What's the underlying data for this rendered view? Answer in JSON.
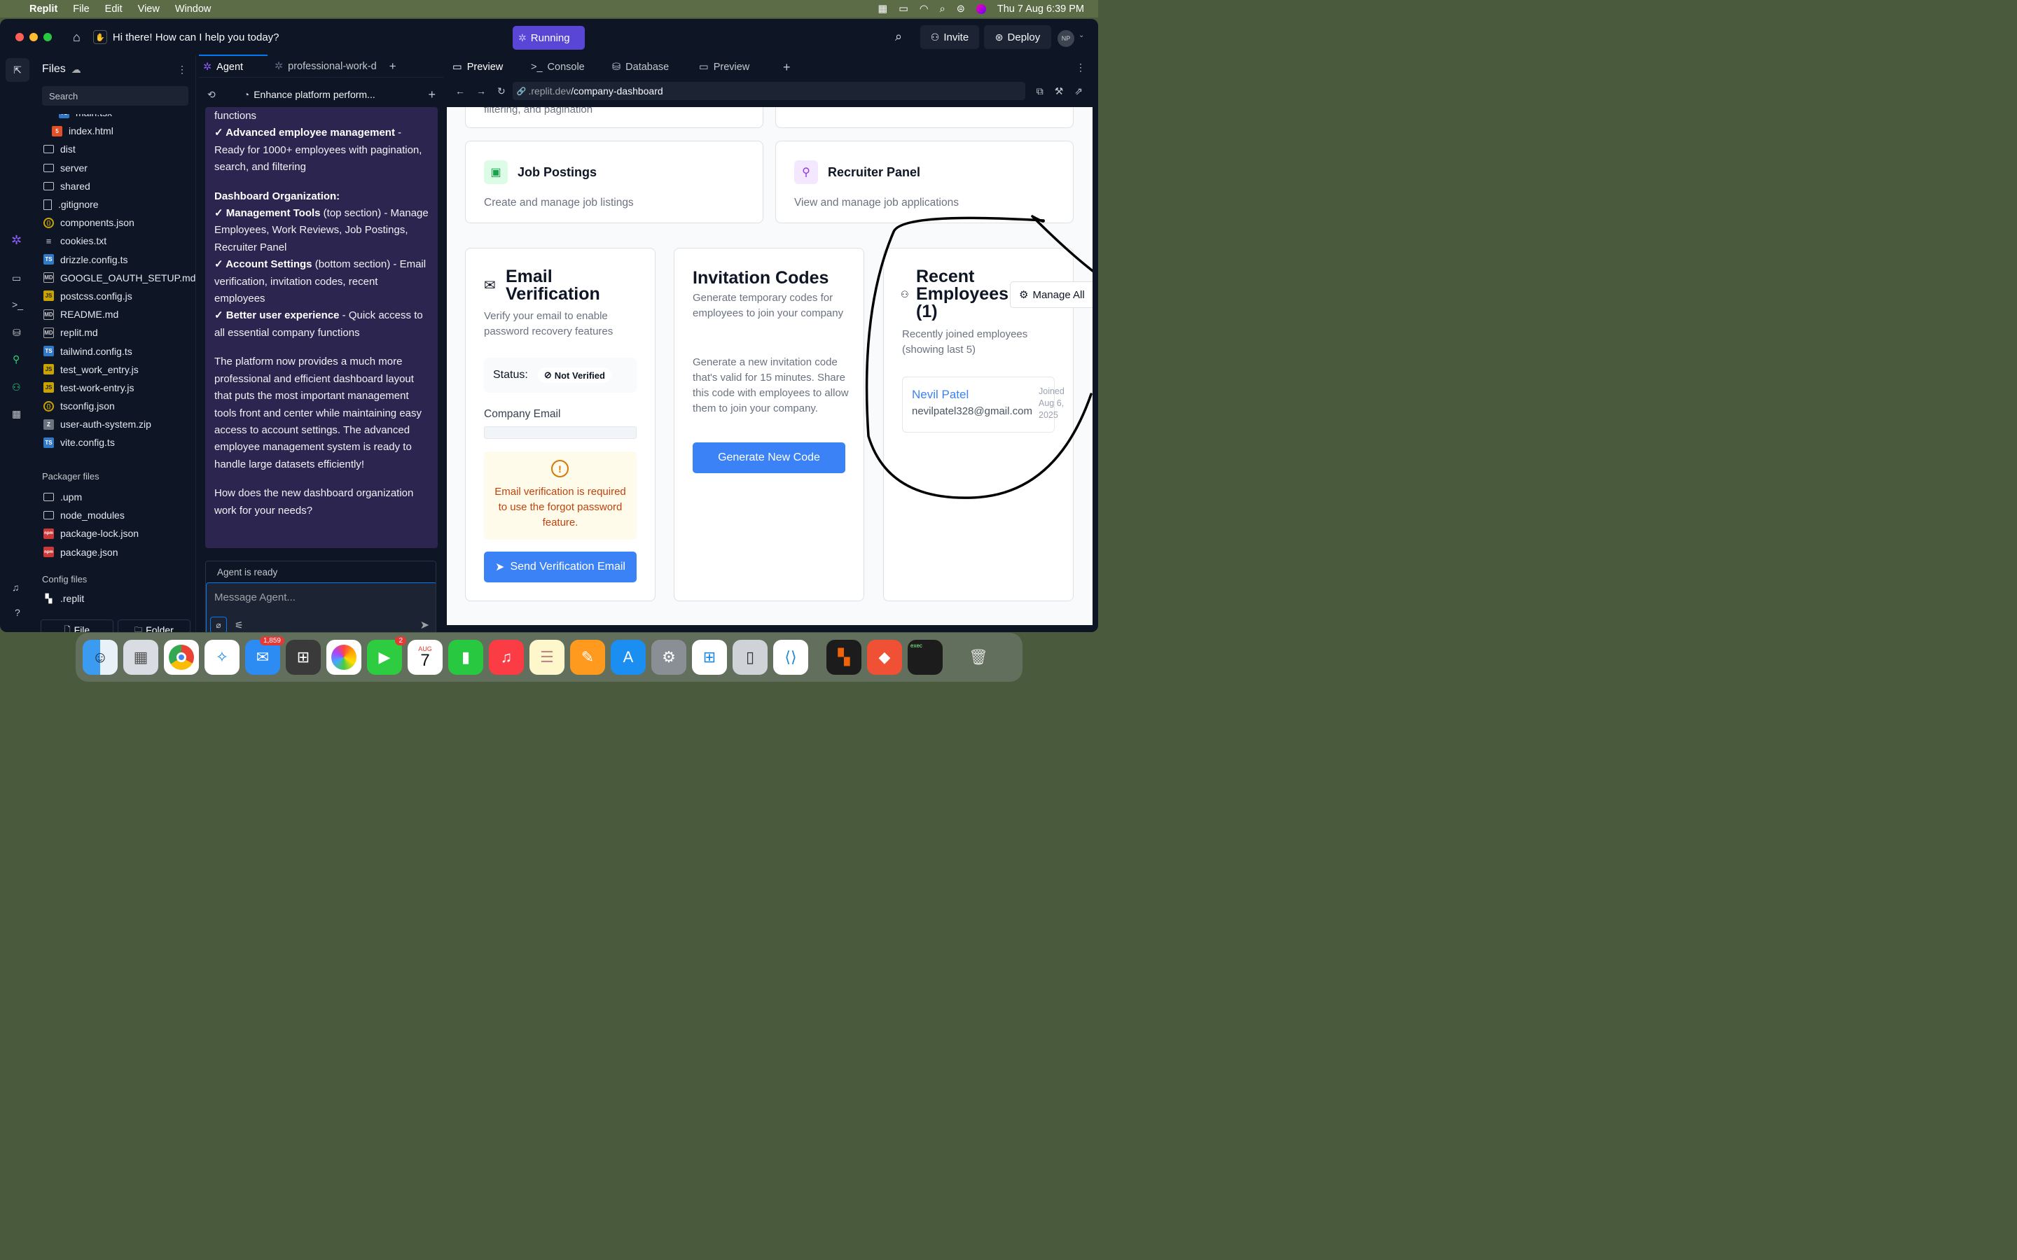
{
  "menubar": {
    "app_name": "Replit",
    "items": [
      "File",
      "Edit",
      "View",
      "Window"
    ],
    "clock": "Thu 7 Aug  6:39 PM"
  },
  "titlebar": {
    "prompt": "Hi there! How can I help you today?",
    "running_label": "Running",
    "invite_label": "Invite",
    "deploy_label": "Deploy",
    "avatar_initials": "NP"
  },
  "files": {
    "header": "Files",
    "search_placeholder": "Search",
    "items": [
      {
        "name": "main.tsx",
        "icon": "ts"
      },
      {
        "name": "index.html",
        "icon": "html"
      },
      {
        "name": "dist",
        "icon": "folder"
      },
      {
        "name": "server",
        "icon": "folder"
      },
      {
        "name": "shared",
        "icon": "folder"
      },
      {
        "name": ".gitignore",
        "icon": "file"
      },
      {
        "name": "components.json",
        "icon": "json"
      },
      {
        "name": "cookies.txt",
        "icon": "txt"
      },
      {
        "name": "drizzle.config.ts",
        "icon": "ts"
      },
      {
        "name": "GOOGLE_OAUTH_SETUP.md",
        "icon": "md"
      },
      {
        "name": "postcss.config.js",
        "icon": "js"
      },
      {
        "name": "README.md",
        "icon": "md"
      },
      {
        "name": "replit.md",
        "icon": "md"
      },
      {
        "name": "tailwind.config.ts",
        "icon": "ts"
      },
      {
        "name": "test_work_entry.js",
        "icon": "js"
      },
      {
        "name": "test-work-entry.js",
        "icon": "js"
      },
      {
        "name": "tsconfig.json",
        "icon": "json"
      },
      {
        "name": "user-auth-system.zip",
        "icon": "zip"
      },
      {
        "name": "vite.config.ts",
        "icon": "ts"
      }
    ],
    "packager_title": "Packager files",
    "packager_items": [
      {
        "name": ".upm",
        "icon": "folder"
      },
      {
        "name": "node_modules",
        "icon": "folder"
      },
      {
        "name": "package-lock.json",
        "icon": "npm"
      },
      {
        "name": "package.json",
        "icon": "npm"
      }
    ],
    "config_title": "Config files",
    "config_items": [
      {
        "name": ".replit",
        "icon": "replit"
      }
    ],
    "new_file_label": "File",
    "new_folder_label": "Folder"
  },
  "chat": {
    "tab_agent": "Agent",
    "tab_other": "professional-work-d",
    "thread_title": "Enhance platform perform...",
    "msg": {
      "p0": "functions",
      "p1_check": "✓ ",
      "p1_bold": "Advanced employee management",
      "p1_rest": " - Ready for 1000+ employees with pagination, search, and filtering",
      "p2_title": "Dashboard Organization:",
      "p3_bold": "Management Tools",
      "p3_rest": " (top section) - Manage Employees, Work Reviews, Job Postings, Recruiter Panel",
      "p4_bold": "Account Settings",
      "p4_rest": " (bottom section) - Email verification, invitation codes, recent employees",
      "p5_bold": "Better user experience",
      "p5_rest": " - Quick access to all essential company functions",
      "p6": "The platform now provides a much more professional and efficient dashboard layout that puts the most important management tools front and center while maintaining easy access to account settings. The advanced employee management system is ready to handle large datasets efficiently!",
      "p7": "How does the new dashboard organization work for your needs?"
    },
    "status": "Agent is ready",
    "input_placeholder": "Message Agent..."
  },
  "preview": {
    "tabs": [
      "Preview",
      "Console",
      "Database",
      "Preview"
    ],
    "url_prefix": ".replit.dev",
    "url_path": "/company-dashboard",
    "top_card_text": "filtering, and pagination",
    "job_title": "Job Postings",
    "job_desc": "Create and manage job listings",
    "recruiter_title": "Recruiter Panel",
    "recruiter_desc": "View and manage job applications",
    "email": {
      "title": "Email Verification",
      "desc": "Verify your email to enable password recovery features",
      "status_label": "Status:",
      "status_value": "Not Verified",
      "company_email_label": "Company Email",
      "warning": "Email verification is required to use the forgot password feature.",
      "button": "Send Verification Email"
    },
    "invite": {
      "title": "Invitation Codes",
      "desc": "Generate temporary codes for employees to join your company",
      "body": "Generate a new invitation code that's valid for 15 minutes. Share this code with employees to allow them to join your company.",
      "button": "Generate New Code"
    },
    "recent": {
      "title": "Recent Employees (1)",
      "manage_label": "Manage All",
      "desc": "Recently joined employees (showing last 5)",
      "employee_name": "Nevil Patel",
      "employee_email": "nevilpatel328@gmail.com",
      "joined": "Joined Aug 6, 2025"
    }
  },
  "dock": {
    "mail_badge": "1,859",
    "facetime_badge": "2",
    "calendar_month": "AUG",
    "calendar_day": "7",
    "terminal_label": "exec"
  }
}
